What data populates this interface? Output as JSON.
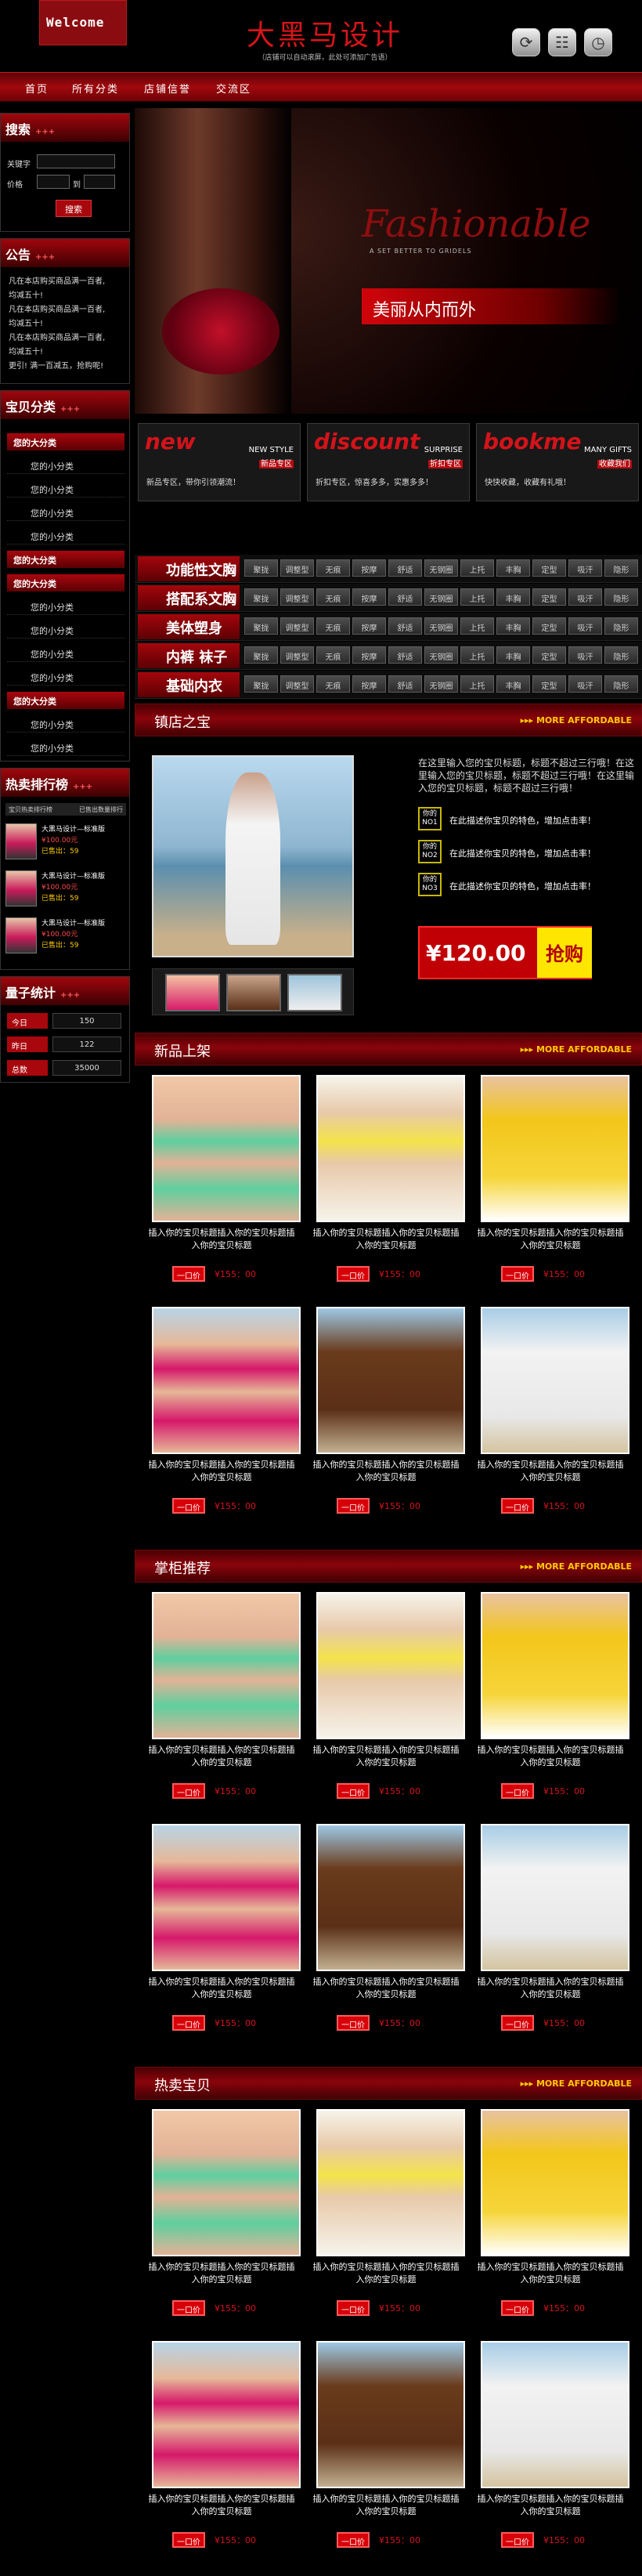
{
  "header": {
    "welcome": "Welcome",
    "title": "大黑马设计",
    "subtitle": "（店铺可以自动滚屏，此处可添加广告语）"
  },
  "nav": [
    "首页",
    "所有分类",
    "店铺信誉",
    "交流区"
  ],
  "search": {
    "title": "搜索",
    "keyword_label": "关键字",
    "price_label": "价格",
    "price_sep": "到",
    "button": "搜索"
  },
  "notice": {
    "title": "公告",
    "lines": [
      "凡在本店购买商品满一百者,",
      "均减五十!",
      "凡在本店购买商品满一百者,",
      "均减五十!",
      "凡在本店购买商品满一百者,",
      "均减五十!",
      "更引! 满一百减五，抢购呢!"
    ]
  },
  "categories": {
    "title": "宝贝分类",
    "groups": [
      {
        "name": "您的大分类",
        "items": [
          "您的小分类",
          "您的小分类",
          "您的小分类",
          "您的小分类"
        ]
      },
      {
        "name": "您的大分类",
        "items": []
      },
      {
        "name": "您的大分类",
        "items": [
          "您的小分类",
          "您的小分类",
          "您的小分类",
          "您的小分类"
        ]
      },
      {
        "name": "您的大分类",
        "items": [
          "您的小分类",
          "您的小分类"
        ]
      }
    ]
  },
  "hot": {
    "title": "热卖排行榜",
    "header_left": "宝贝热卖排行榜",
    "header_right": "已售出数量排行",
    "items": [
      {
        "name": "大黑马设计—标准版",
        "price": "¥100.00元",
        "sold": "已售出：59"
      },
      {
        "name": "大黑马设计—标准版",
        "price": "¥100.00元",
        "sold": "已售出：59"
      },
      {
        "name": "大黑马设计—标准版",
        "price": "¥100.00元",
        "sold": "已售出：59"
      }
    ]
  },
  "stats": {
    "title": "量子统计",
    "rows": [
      {
        "label": "今日",
        "value": "150"
      },
      {
        "label": "昨日",
        "value": "122"
      },
      {
        "label": "总数",
        "value": "35000"
      }
    ]
  },
  "banner": {
    "en": "Fashionable",
    "tag": "A SET BETTER TO GRIDELS",
    "cn": "美丽从内而外"
  },
  "promos": [
    {
      "big": "new",
      "t1": "NEW STYLE",
      "t2": "新品专区",
      "desc": "新品专区，带你引领潮流！"
    },
    {
      "big": "discount",
      "t1": "SURPRISE",
      "t2": "折扣专区",
      "desc": "折扣专区，惊喜多多，实惠多多！"
    },
    {
      "big": "bookme",
      "t1": "MANY GIFTS",
      "t2": "收藏我们",
      "desc": "快快收藏，收藏有礼哦！"
    }
  ],
  "cat_rows": [
    {
      "name": "功能性文胸",
      "tags": [
        "聚拢",
        "调整型",
        "无痕",
        "按摩",
        "舒适",
        "无钢圈",
        "上托",
        "丰胸",
        "定型",
        "吸汗",
        "隐形"
      ]
    },
    {
      "name": "搭配系文胸",
      "tags": [
        "聚拢",
        "调整型",
        "无痕",
        "按摩",
        "舒适",
        "无钢圈",
        "上托",
        "丰胸",
        "定型",
        "吸汗",
        "隐形"
      ]
    },
    {
      "name": "美体塑身",
      "tags": [
        "聚拢",
        "调整型",
        "无痕",
        "按摩",
        "舒适",
        "无钢圈",
        "上托",
        "丰胸",
        "定型",
        "吸汗",
        "隐形"
      ]
    },
    {
      "name": "内裤 袜子",
      "tags": [
        "聚拢",
        "调整型",
        "无痕",
        "按摩",
        "舒适",
        "无钢圈",
        "上托",
        "丰胸",
        "定型",
        "吸汗",
        "隐形"
      ]
    },
    {
      "name": "基础内衣",
      "tags": [
        "聚拢",
        "调整型",
        "无痕",
        "按摩",
        "舒适",
        "无钢圈",
        "上托",
        "丰胸",
        "定型",
        "吸汗",
        "隐形"
      ]
    }
  ],
  "sections": {
    "featured": "镇店之宝",
    "new": "新品上架",
    "recommend": "掌柜推荐",
    "hot": "热卖宝贝",
    "more": "MORE AFFORDABLE"
  },
  "featured": {
    "desc": "在这里输入您的宝贝标题，标题不超过三行哦！在这里输入您的宝贝标题，标题不超过三行哦！在这里输入您的宝贝标题，标题不超过三行哦！",
    "notes": [
      {
        "badge": "你的 NO1",
        "text": "在此描述你宝贝的特色，增加点击率！"
      },
      {
        "badge": "你的 NO2",
        "text": "在此描述你宝贝的特色，增加点击率！"
      },
      {
        "badge": "你的 NO3",
        "text": "在此描述你宝贝的特色，增加点击率！"
      }
    ],
    "price": "¥120.00",
    "buy": "抢购"
  },
  "product": {
    "title": "插入你的宝贝标题插入你的宝贝标题插入你的宝贝标题",
    "buy": "一口价",
    "price": "¥155：00"
  },
  "colors": {
    "accent": "#a8070d",
    "yellow": "#ffe600",
    "bg": "#000000"
  }
}
